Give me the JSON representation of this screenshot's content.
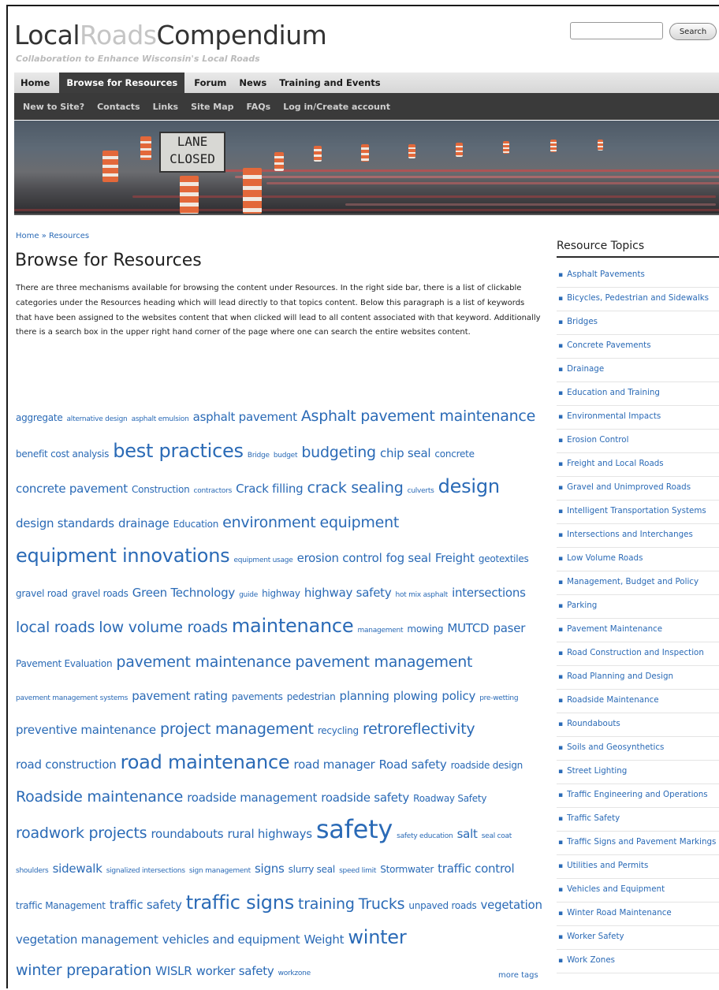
{
  "header": {
    "logo_part1": "Local",
    "logo_part2": "Roads",
    "logo_part3": "Compendium",
    "tagline": "Collaboration to Enhance Wisconsin's Local Roads",
    "search_button": "Search",
    "search_value": ""
  },
  "primary_nav": [
    "Home",
    "Browse for Resources",
    "Forum",
    "News",
    "Training and Events"
  ],
  "primary_nav_active": "Browse for Resources",
  "secondary_nav": [
    "New to Site?",
    "Contacts",
    "Links",
    "Site Map",
    "FAQs",
    "Log in/Create account"
  ],
  "banner": {
    "sign_line1": "LANE",
    "sign_line2": "CLOSED"
  },
  "breadcrumb": "Home » Resources",
  "page_title": "Browse for Resources",
  "intro": "There are three mechanisms available for browsing the content under Resources.  In the right side bar, there is a list of clickable categories under the Resources heading which will lead directly to that topics content.  Below this paragraph is a list of keywords that have been assigned to the websites content that when clicked will lead to all content associated with that keyword.  Additionally  there is a search box in the upper right hand corner of the page where one can search the entire websites content.",
  "tags": [
    {
      "label": "aggregate",
      "weight": 2
    },
    {
      "label": "alternative design",
      "weight": 1
    },
    {
      "label": "asphalt emulsion",
      "weight": 1
    },
    {
      "label": "asphalt pavement",
      "weight": 3
    },
    {
      "label": "Asphalt pavement maintenance",
      "weight": 4
    },
    {
      "label": "benefit cost analysis",
      "weight": 2
    },
    {
      "label": "best practices",
      "weight": 5
    },
    {
      "label": "Bridge",
      "weight": 1
    },
    {
      "label": "budget",
      "weight": 1
    },
    {
      "label": "budgeting",
      "weight": 4
    },
    {
      "label": "chip seal",
      "weight": 3
    },
    {
      "label": "concrete",
      "weight": 2
    },
    {
      "label": "concrete pavement",
      "weight": 3
    },
    {
      "label": "Construction",
      "weight": 2
    },
    {
      "label": "contractors",
      "weight": 1
    },
    {
      "label": "Crack filling",
      "weight": 3
    },
    {
      "label": "crack sealing",
      "weight": 4
    },
    {
      "label": "culverts",
      "weight": 1
    },
    {
      "label": "design",
      "weight": 5
    },
    {
      "label": "design standards",
      "weight": 3
    },
    {
      "label": "drainage",
      "weight": 3
    },
    {
      "label": "Education",
      "weight": 2
    },
    {
      "label": "environment",
      "weight": 4
    },
    {
      "label": "equipment",
      "weight": 4
    },
    {
      "label": "equipment innovations",
      "weight": 5
    },
    {
      "label": "equipment usage",
      "weight": 1
    },
    {
      "label": "erosion control",
      "weight": 3
    },
    {
      "label": "fog seal",
      "weight": 3
    },
    {
      "label": "Freight",
      "weight": 3
    },
    {
      "label": "geotextiles",
      "weight": 2
    },
    {
      "label": "gravel road",
      "weight": 2
    },
    {
      "label": "gravel roads",
      "weight": 2
    },
    {
      "label": "Green Technology",
      "weight": 3
    },
    {
      "label": "guide",
      "weight": 1
    },
    {
      "label": "highway",
      "weight": 2
    },
    {
      "label": "highway safety",
      "weight": 3
    },
    {
      "label": "hot mix asphalt",
      "weight": 1
    },
    {
      "label": "intersections",
      "weight": 3
    },
    {
      "label": "local roads",
      "weight": 4
    },
    {
      "label": "low volume roads",
      "weight": 4
    },
    {
      "label": "maintenance",
      "weight": 5
    },
    {
      "label": "management",
      "weight": 1
    },
    {
      "label": "mowing",
      "weight": 2
    },
    {
      "label": "MUTCD",
      "weight": 3
    },
    {
      "label": "paser",
      "weight": 3
    },
    {
      "label": "Pavement Evaluation",
      "weight": 2
    },
    {
      "label": "pavement maintenance",
      "weight": 4
    },
    {
      "label": "pavement management",
      "weight": 4
    },
    {
      "label": "pavement management systems",
      "weight": 1
    },
    {
      "label": "pavement rating",
      "weight": 3
    },
    {
      "label": "pavements",
      "weight": 2
    },
    {
      "label": "pedestrian",
      "weight": 2
    },
    {
      "label": "planning",
      "weight": 3
    },
    {
      "label": "plowing",
      "weight": 3
    },
    {
      "label": "policy",
      "weight": 3
    },
    {
      "label": "pre-wetting",
      "weight": 1
    },
    {
      "label": "preventive maintenance",
      "weight": 3
    },
    {
      "label": "project management",
      "weight": 4
    },
    {
      "label": "recycling",
      "weight": 2
    },
    {
      "label": "retroreflectivity",
      "weight": 4
    },
    {
      "label": "road construction",
      "weight": 3
    },
    {
      "label": "road maintenance",
      "weight": 5
    },
    {
      "label": "road manager",
      "weight": 3
    },
    {
      "label": "Road safety",
      "weight": 3
    },
    {
      "label": "roadside design",
      "weight": 2
    },
    {
      "label": "Roadside maintenance",
      "weight": 4
    },
    {
      "label": "roadside management",
      "weight": 3
    },
    {
      "label": "roadside safety",
      "weight": 3
    },
    {
      "label": "Roadway Safety",
      "weight": 2
    },
    {
      "label": "roadwork projects",
      "weight": 4
    },
    {
      "label": "roundabouts",
      "weight": 3
    },
    {
      "label": "rural highways",
      "weight": 3
    },
    {
      "label": "safety",
      "weight": 6
    },
    {
      "label": "safety education",
      "weight": 1
    },
    {
      "label": "salt",
      "weight": 3
    },
    {
      "label": "seal coat",
      "weight": 1
    },
    {
      "label": "shoulders",
      "weight": 1
    },
    {
      "label": "sidewalk",
      "weight": 3
    },
    {
      "label": "signalized intersections",
      "weight": 1
    },
    {
      "label": "sign management",
      "weight": 1
    },
    {
      "label": "signs",
      "weight": 3
    },
    {
      "label": "slurry seal",
      "weight": 2
    },
    {
      "label": "speed limit",
      "weight": 1
    },
    {
      "label": "Stormwater",
      "weight": 2
    },
    {
      "label": "traffic control",
      "weight": 3
    },
    {
      "label": "traffic Management",
      "weight": 2
    },
    {
      "label": "traffic safety",
      "weight": 3
    },
    {
      "label": "traffic signs",
      "weight": 5
    },
    {
      "label": "training",
      "weight": 4
    },
    {
      "label": "Trucks",
      "weight": 4
    },
    {
      "label": "unpaved roads",
      "weight": 2
    },
    {
      "label": "vegetation",
      "weight": 3
    },
    {
      "label": "vegetation management",
      "weight": 3
    },
    {
      "label": "vehicles and equipment",
      "weight": 3
    },
    {
      "label": "Weight",
      "weight": 3
    },
    {
      "label": "winter",
      "weight": 5
    },
    {
      "label": "winter preparation",
      "weight": 4
    },
    {
      "label": "WISLR",
      "weight": 3
    },
    {
      "label": "worker safety",
      "weight": 3
    },
    {
      "label": "workzone",
      "weight": 1
    }
  ],
  "more_tags": "more tags",
  "sidebar": {
    "heading": "Resource Topics",
    "items": [
      "Asphalt Pavements",
      "Bicycles, Pedestrian and Sidewalks",
      "Bridges",
      "Concrete Pavements",
      "Drainage",
      "Education and Training",
      "Environmental Impacts",
      "Erosion Control",
      "Freight and Local Roads",
      "Gravel and Unimproved Roads",
      "Intelligent Transportation Systems",
      "Intersections and Interchanges",
      "Low Volume Roads",
      "Management, Budget and Policy",
      "Parking",
      "Pavement Maintenance",
      "Road Construction and Inspection",
      "Road Planning and Design",
      "Roadside Maintenance",
      "Roundabouts",
      "Soils and Geosynthetics",
      "Street Lighting",
      "Traffic Engineering and Operations",
      "Traffic Safety",
      "Traffic Signs and Pavement Markings",
      "Utilities and Permits",
      "Vehicles and Equipment",
      "Winter Road Maintenance",
      "Worker Safety",
      "Work Zones"
    ]
  },
  "colors": {
    "link": "#2a6ab6",
    "nav_dark": "#3a3a3a",
    "nav_light": "#e0e0e0"
  }
}
